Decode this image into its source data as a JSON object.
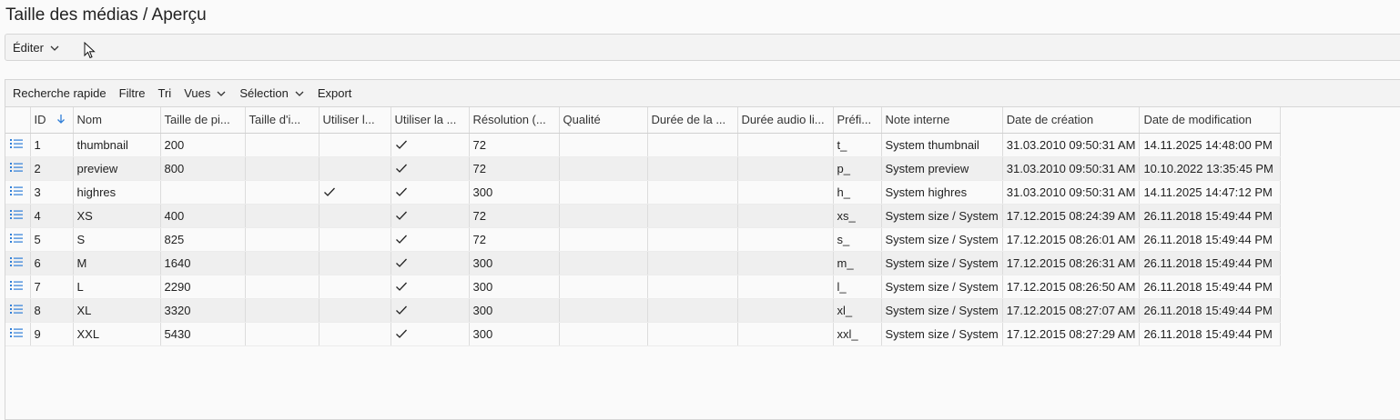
{
  "page": {
    "title": "Taille des médias / Aperçu"
  },
  "edit_bar": {
    "edit_label": "Éditer"
  },
  "toolbar": {
    "quick_search": "Recherche rapide",
    "filter": "Filtre",
    "sort": "Tri",
    "views": "Vues",
    "selection": "Sélection",
    "export": "Export"
  },
  "columns": [
    "ID",
    "Nom",
    "Taille de pi...",
    "Taille d'i...",
    "Utiliser l...",
    "Utiliser la ...",
    "Résolution (...",
    "Qualité",
    "Durée de la ...",
    "Durée audio li...",
    "Préfi...",
    "Note interne",
    "Date de création",
    "Date de modification"
  ],
  "rows": [
    {
      "id": "1",
      "name": "thumbnail",
      "px": "200",
      "size": "",
      "use_l": false,
      "use_la": true,
      "res": "72",
      "quality": "",
      "dur": "",
      "audio": "",
      "prefix": "t_",
      "note": "System thumbnail",
      "created": "31.03.2010 09:50:31 AM",
      "modified": "14.11.2025 14:48:00 PM"
    },
    {
      "id": "2",
      "name": "preview",
      "px": "800",
      "size": "",
      "use_l": false,
      "use_la": true,
      "res": "72",
      "quality": "",
      "dur": "",
      "audio": "",
      "prefix": "p_",
      "note": "System preview",
      "created": "31.03.2010 09:50:31 AM",
      "modified": "10.10.2022 13:35:45 PM"
    },
    {
      "id": "3",
      "name": "highres",
      "px": "",
      "size": "",
      "use_l": true,
      "use_la": true,
      "res": "300",
      "quality": "",
      "dur": "",
      "audio": "",
      "prefix": "h_",
      "note": "System highres",
      "created": "31.03.2010 09:50:31 AM",
      "modified": "14.11.2025 14:47:12 PM"
    },
    {
      "id": "4",
      "name": "XS",
      "px": "400",
      "size": "",
      "use_l": false,
      "use_la": true,
      "res": "72",
      "quality": "",
      "dur": "",
      "audio": "",
      "prefix": "xs_",
      "note": "System size / System",
      "created": "17.12.2015 08:24:39 AM",
      "modified": "26.11.2018 15:49:44 PM"
    },
    {
      "id": "5",
      "name": "S",
      "px": "825",
      "size": "",
      "use_l": false,
      "use_la": true,
      "res": "72",
      "quality": "",
      "dur": "",
      "audio": "",
      "prefix": "s_",
      "note": "System size / System",
      "created": "17.12.2015 08:26:01 AM",
      "modified": "26.11.2018 15:49:44 PM"
    },
    {
      "id": "6",
      "name": "M",
      "px": "1640",
      "size": "",
      "use_l": false,
      "use_la": true,
      "res": "300",
      "quality": "",
      "dur": "",
      "audio": "",
      "prefix": "m_",
      "note": "System size / System",
      "created": "17.12.2015 08:26:31 AM",
      "modified": "26.11.2018 15:49:44 PM"
    },
    {
      "id": "7",
      "name": "L",
      "px": "2290",
      "size": "",
      "use_l": false,
      "use_la": true,
      "res": "300",
      "quality": "",
      "dur": "",
      "audio": "",
      "prefix": "l_",
      "note": "System size / System",
      "created": "17.12.2015 08:26:50 AM",
      "modified": "26.11.2018 15:49:44 PM"
    },
    {
      "id": "8",
      "name": "XL",
      "px": "3320",
      "size": "",
      "use_l": false,
      "use_la": true,
      "res": "300",
      "quality": "",
      "dur": "",
      "audio": "",
      "prefix": "xl_",
      "note": "System size / System",
      "created": "17.12.2015 08:27:07 AM",
      "modified": "26.11.2018 15:49:44 PM"
    },
    {
      "id": "9",
      "name": "XXL",
      "px": "5430",
      "size": "",
      "use_l": false,
      "use_la": true,
      "res": "300",
      "quality": "",
      "dur": "",
      "audio": "",
      "prefix": "xxl_",
      "note": "System size / System",
      "created": "17.12.2015 08:27:29 AM",
      "modified": "26.11.2018 15:49:44 PM"
    }
  ],
  "icons": {
    "row_icon": "list-icon",
    "sort_icon": "arrow-down-icon",
    "check_icon": "checkmark-icon",
    "chevron": "chevron-down-icon"
  },
  "colors": {
    "accent": "#2f7ed8"
  }
}
